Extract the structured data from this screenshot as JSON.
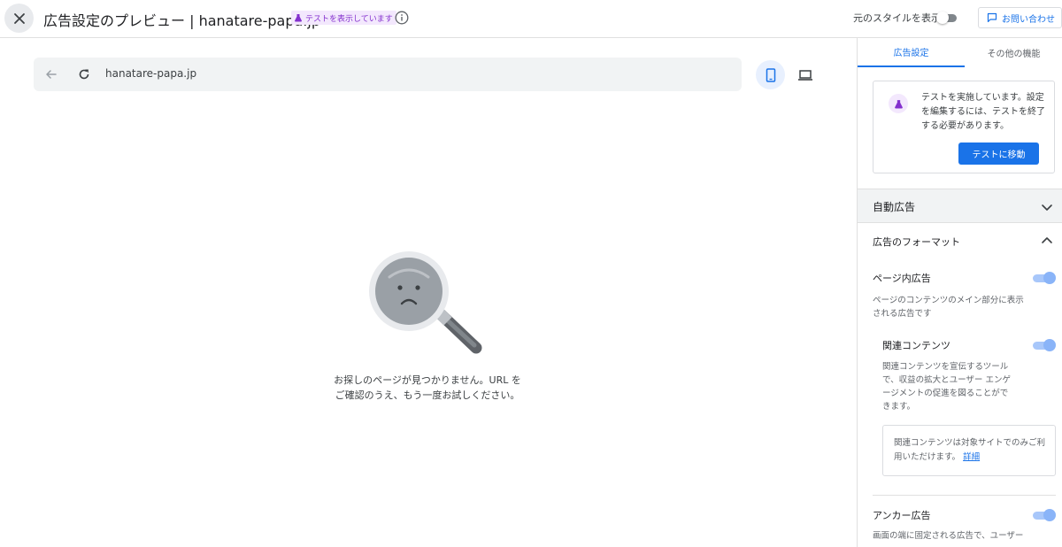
{
  "header": {
    "title": "広告設定のプレビュー | hanatare-papa.jp",
    "test_badge": "テストを表示しています",
    "original_style_label": "元のスタイルを表示",
    "contact_label": "お問い合わせ"
  },
  "browser": {
    "url": "hanatare-papa.jp"
  },
  "preview": {
    "not_found_message": "お探しのページが見つかりません。URL を ご確認のうえ、もう一度お試しください。"
  },
  "panel": {
    "tabs": [
      "広告設定",
      "その他の機能"
    ],
    "active_tab": 0,
    "test_card": {
      "message": "テストを実施しています。設定を編集するには、テストを終了する必要があります。",
      "button_label": "テストに移動"
    },
    "auto_ads_label": "自動広告",
    "ad_formats_label": "広告のフォーマット",
    "in_page": {
      "title": "ページ内広告",
      "description": "ページのコンテンツのメイン部分に表示される広告です",
      "enabled": true
    },
    "related": {
      "title": "関連コンテンツ",
      "description": "関連コンテンツを宣伝するツールで、収益の拡大とユーザー エンゲージメントの促進を図ることができます。",
      "enabled": true,
      "note": "関連コンテンツは対象サイトでのみご利用いただけます。",
      "note_link": "詳細"
    },
    "anchor": {
      "title": "アンカー広告",
      "description": "画面の端に固定される広告で、ユーザー",
      "enabled": true
    }
  },
  "colors": {
    "accent": "#1a73e8",
    "test_purple": "#8430ce",
    "toggle_on": "#8ab4f8"
  }
}
